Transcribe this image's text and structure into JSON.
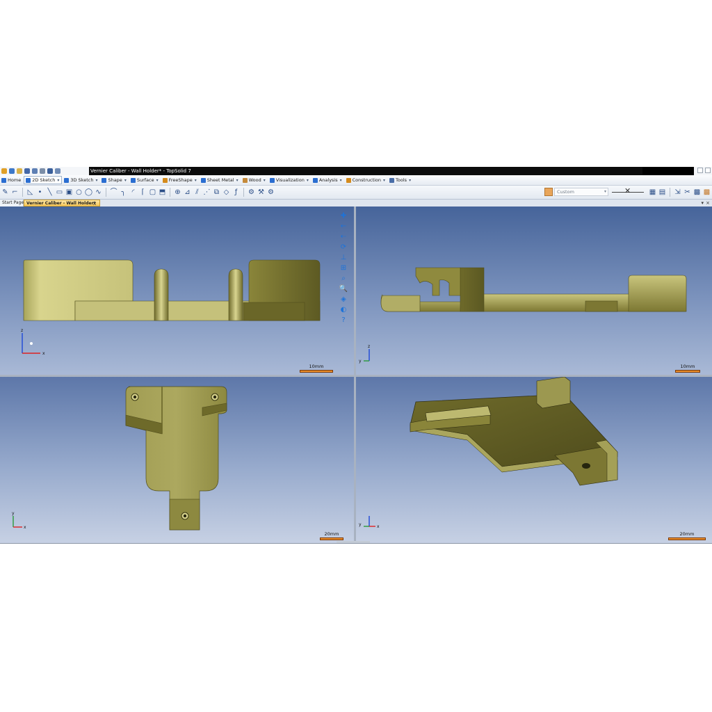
{
  "window": {
    "title": "Vernier Caliber - Wall Holder* - TopSolid 7"
  },
  "menu": {
    "items": [
      {
        "label": "Home",
        "icon_color": "#2b6ed1"
      },
      {
        "label": "2D Sketch",
        "icon_color": "#2b6ed1",
        "active": true
      },
      {
        "label": "3D Sketch",
        "icon_color": "#2b6ed1"
      },
      {
        "label": "Shape",
        "icon_color": "#2b6ed1"
      },
      {
        "label": "Surface",
        "icon_color": "#2b6ed1"
      },
      {
        "label": "FreeShape",
        "icon_color": "#d48b1c"
      },
      {
        "label": "Sheet Metal",
        "icon_color": "#2b6ed1"
      },
      {
        "label": "Wood",
        "icon_color": "#c58a3a"
      },
      {
        "label": "Visualization",
        "icon_color": "#2b6ed1"
      },
      {
        "label": "Analysis",
        "icon_color": "#2b6ed1"
      },
      {
        "label": "Construction",
        "icon_color": "#d48b1c"
      },
      {
        "label": "Tools",
        "icon_color": "#4a6ea8"
      }
    ],
    "dropdown_glyph": "▾"
  },
  "toolbar": {
    "style_combo_value": "Custom",
    "line_style_glyph": "✕"
  },
  "tabs": {
    "start_label": "Start Page",
    "document_label": "Vernier Caliber - Wall Holder*",
    "close_glyph": "×",
    "menu_glyph": "▾"
  },
  "viewports": {
    "front": {
      "scale_label": "10mm",
      "axis_labels": [
        "z",
        "x"
      ]
    },
    "side": {
      "scale_label": "10mm",
      "axis_labels": [
        "z",
        "y"
      ]
    },
    "top": {
      "scale_label": "20mm",
      "axis_labels": [
        "y",
        "x"
      ]
    },
    "iso": {
      "scale_label": "20mm",
      "axis_labels": [
        "y",
        "x"
      ]
    }
  },
  "colors": {
    "part_light": "#c9c579",
    "part_mid": "#8f8a3e",
    "part_dark": "#5d5a23",
    "viewport_top": "#46649a",
    "scale_bar": "#e88c2b",
    "active_tab": "#f7c75a"
  },
  "view_tools": [
    {
      "icon": "crosshair-icon",
      "glyph": "✚"
    },
    {
      "icon": "arrow-left-icon",
      "glyph": "←"
    },
    {
      "icon": "arrow-steps-icon",
      "glyph": "⇠"
    },
    {
      "icon": "rotate-icon",
      "glyph": "⟳"
    },
    {
      "icon": "axis-view-icon",
      "glyph": "⊥"
    },
    {
      "icon": "four-views-icon",
      "glyph": "⊞"
    },
    {
      "icon": "zoom-window-icon",
      "glyph": "⌕"
    },
    {
      "icon": "zoom-icon",
      "glyph": "🔍"
    },
    {
      "icon": "cube-view-icon",
      "glyph": "◈"
    },
    {
      "icon": "palette-icon",
      "glyph": "◐"
    },
    {
      "icon": "help-icon",
      "glyph": "?"
    }
  ]
}
